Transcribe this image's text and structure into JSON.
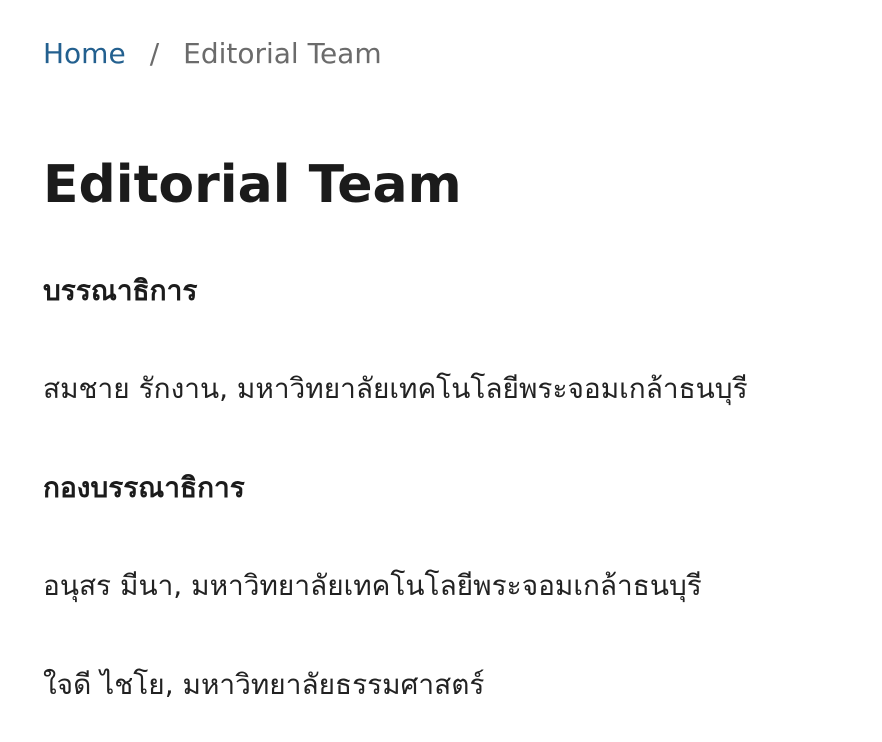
{
  "breadcrumb": {
    "home_label": "Home",
    "separator": "/",
    "current_label": "Editorial Team"
  },
  "page": {
    "title": "Editorial Team"
  },
  "sections": [
    {
      "heading": "บรรณาธิการ",
      "members": [
        "สมชาย รักงาน, มหาวิทยาลัยเทคโนโลยีพระจอมเกล้าธนบุรี"
      ]
    },
    {
      "heading": "กองบรรณาธิการ",
      "members": [
        "อนุสร มีนา, มหาวิทยาลัยเทคโนโลยีพระจอมเกล้าธนบุรี",
        "ใจดี ไชโย, มหาวิทยาลัยธรรมศาสตร์"
      ]
    }
  ],
  "colors": {
    "link": "#23608f",
    "muted": "#6b6b6b",
    "text": "#222222"
  }
}
